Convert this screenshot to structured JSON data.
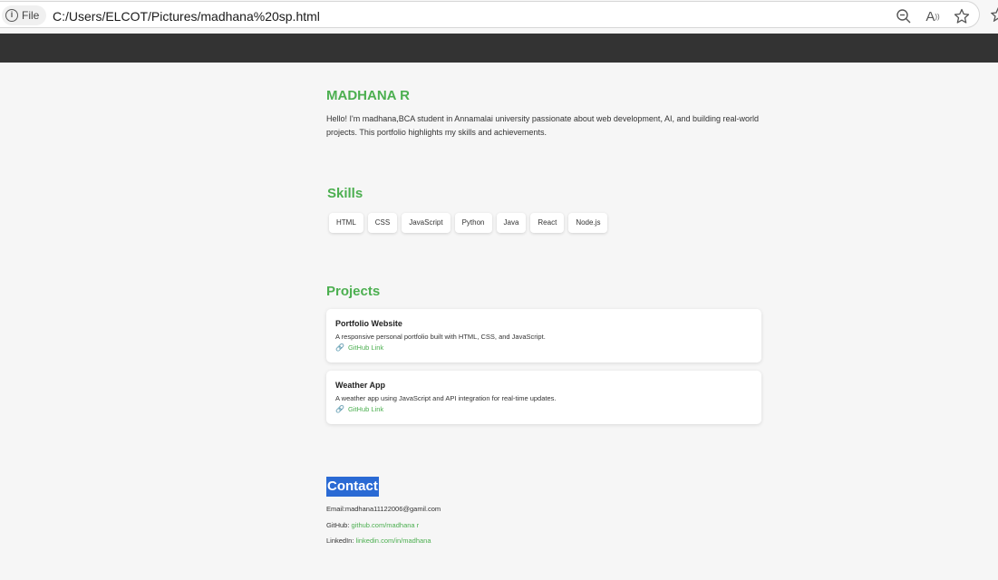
{
  "browser": {
    "site_info_label": "File",
    "url": "C:/Users/ELCOT/Pictures/madhana%20sp.html",
    "read_aloud_label": "A",
    "read_aloud_sup": "))"
  },
  "header": {
    "name": "MADHANA R",
    "intro": "Hello! I'm madhana,BCA student in Annamalai university passionate about web development, AI, and building real-world projects. This portfolio highlights my skills and achievements."
  },
  "skills": {
    "heading": "Skills",
    "items": [
      "HTML",
      "CSS",
      "JavaScript",
      "Python",
      "Java",
      "React",
      "Node.js"
    ]
  },
  "projects": {
    "heading": "Projects",
    "items": [
      {
        "title": "Portfolio Website",
        "description": "A responsive personal portfolio built with HTML, CSS, and JavaScript.",
        "link_icon": "🔗",
        "link_label": "GitHub Link"
      },
      {
        "title": "Weather App",
        "description": "A weather app using JavaScript and API integration for real-time updates.",
        "link_icon": "🔗",
        "link_label": "GitHub Link"
      }
    ]
  },
  "contact": {
    "heading": "Contact",
    "email_label": "Email:",
    "email": "madhana11122006@gamil.com",
    "github_label": "GitHub:",
    "github": "github.com/madhana r",
    "linkedin_label": "LinkedIn:",
    "linkedin": "linkedin.com/in/madhana"
  },
  "colors": {
    "accent_green": "#4caf50",
    "nav_dark": "#333333",
    "selection_blue": "#2a6ad4",
    "page_bg": "#f6f6f6"
  },
  "icons": [
    "info-icon",
    "zoom-out-icon",
    "read-aloud-icon",
    "favorite-star-icon",
    "link-icon"
  ]
}
